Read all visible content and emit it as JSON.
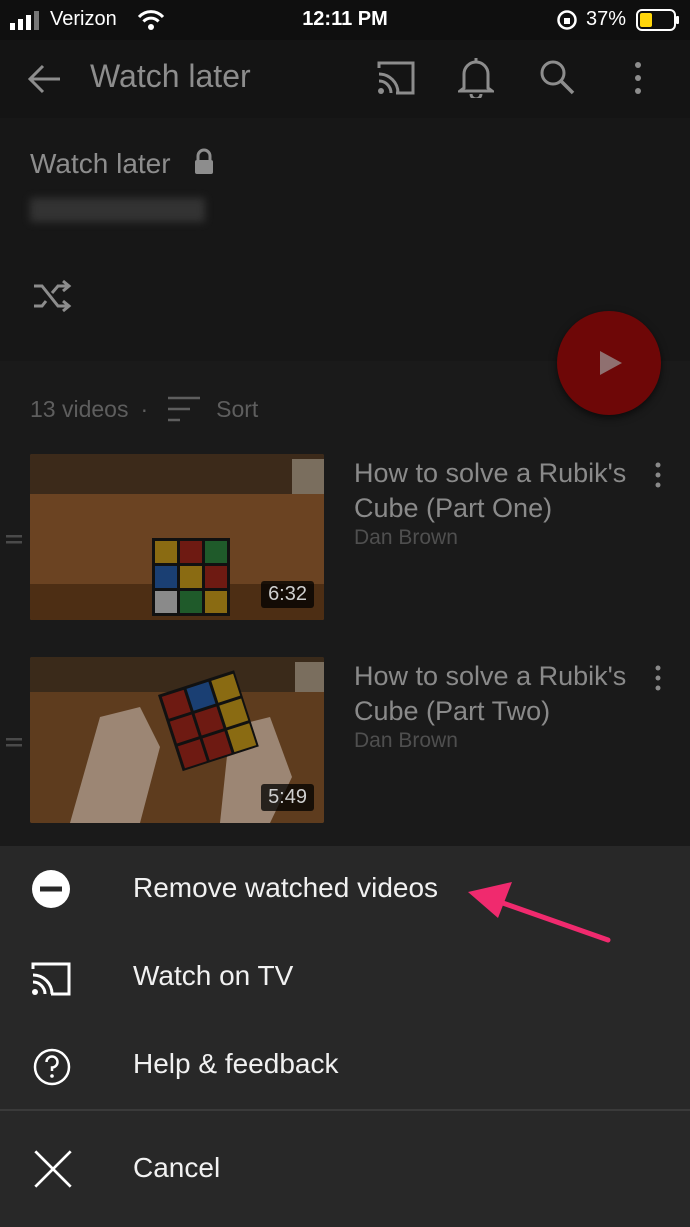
{
  "status_bar": {
    "carrier": "Verizon",
    "time": "12:11 PM",
    "battery": "37%"
  },
  "app_bar": {
    "title": "Watch later",
    "icons": [
      "back-arrow-icon",
      "cast-icon",
      "bell-icon",
      "search-icon",
      "more-vert-icon"
    ]
  },
  "playlist": {
    "title": "Watch later",
    "privacy_icon": "lock-icon",
    "shuffle_icon": "shuffle-icon",
    "play_icon": "play-icon"
  },
  "list_meta": {
    "count": "13 videos",
    "separator": "·",
    "sort_label": "Sort"
  },
  "videos": [
    {
      "title": "How to solve a Rubik's Cube (Part One)",
      "channel": "Dan Brown",
      "duration": "6:32"
    },
    {
      "title": "How to solve a Rubik's Cube (Part Two)",
      "channel": "Dan Brown",
      "duration": "5:49"
    }
  ],
  "sheet": {
    "items": [
      {
        "label": "Remove watched videos",
        "icon": "remove-circle-icon"
      },
      {
        "label": "Watch on TV",
        "icon": "cast-icon"
      },
      {
        "label": "Help & feedback",
        "icon": "help-circle-icon"
      }
    ],
    "cancel": {
      "label": "Cancel",
      "icon": "close-icon"
    }
  },
  "colors": {
    "annotation_arrow": "#f02a6e",
    "fab": "#6e0707"
  }
}
